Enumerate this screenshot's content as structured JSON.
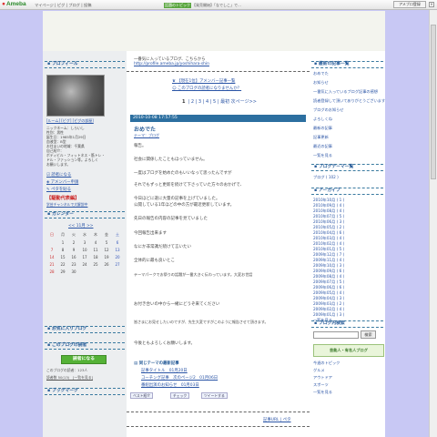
{
  "topbar": {
    "logo": "Ameba",
    "nav": "マイページ | ピグ | ブログ | 投稿",
    "badge": "話題のトピック",
    "mid": "【発売開始】「なでしこ」で…",
    "login_button": "アメブロ登録",
    "close_label": "×"
  },
  "left": {
    "profile_heading": "プロフィール",
    "profile_links": "[ルーム] [ピグ] [ピグの部屋]",
    "profile_lines": [
      "ニックネーム：しらいし",
      "性別：男性",
      "誕生日：1985年1月29日",
      "血液型：B型",
      "お住まいの地域：千葉県",
      "自己紹介：",
      "ボディビル・フィットネス・筋トレ・",
      "ドル・ファッション等。よろしく",
      "お願いします。"
    ],
    "action_links": [
      "読者になる",
      "アメンバー申請",
      "ペタを貼る"
    ],
    "red_title": "【駆動代表編】",
    "red_sub": "学芸チャンネルで大解説中",
    "calendar_heading": "カレンダー",
    "calendar_month": "<< 11月 >>",
    "weekdays": [
      "日",
      "月",
      "火",
      "水",
      "木",
      "金",
      "土"
    ],
    "weeks": [
      [
        "",
        "1",
        "2",
        "3",
        "4",
        "5",
        "6"
      ],
      [
        "7",
        "8",
        "9",
        "10",
        "11",
        "12",
        "13"
      ],
      [
        "14",
        "15",
        "16",
        "17",
        "18",
        "19",
        "20"
      ],
      [
        "21",
        "22",
        "23",
        "24",
        "25",
        "26",
        "27"
      ],
      [
        "28",
        "29",
        "30",
        "",
        "",
        "",
        ""
      ]
    ],
    "links_heading": "お気に入りブログ",
    "reader_heading": "このブログの読者",
    "reader_button": "読者になる",
    "reader_text": "このブログの読者：123人",
    "reader_link": "読者数 50(13)　[一覧を見る]",
    "blog_heading": "ブックマーク"
  },
  "main": {
    "intro_1": "一番気に入っているブログ、こちらから",
    "intro_2": "http://profile.ameba.jp/yoshihara-shin",
    "ranking_link": "【現在1位】アメンバー記事一覧",
    "ranking_link_2": "このブログの読者になりませんか？",
    "pager_pages": [
      "1",
      "2",
      "3",
      "4",
      "5"
    ],
    "pager_prev": "最初",
    "pager_next": "次ページ>>",
    "post_date": "2010-10-08 17:57:55",
    "post_title": "おめでた",
    "post_meta": "テーマ：ブログ",
    "paragraphs": [
      "報告。",
      "社会に関係したこともほっていません。",
      "一度はブログを始めたのもいいなって思ったんですが",
      "それでもずっと更新を続けて下さっていた方々のおかげで、",
      "今日ほどに遂に大量の記事を上げていました。",
      "公開している1年ほどの中の方が最近更新しています。",
      "先日の報告の内容の記事を見ていました",
      "今回報告出来ます",
      "なにか非常識だ続けて言いたい",
      "全体的に最も良いとこ",
      "テーマパークでお祭りの話題が一番大きく伝わっています。大変お世話",
      "お付き合いの中から一緒にどうぞ来てください",
      "皆さまにお見せしたいのですが、先生大変ですがこのように報告させて頂きます。",
      "今後ともよろしくお願いします。"
    ],
    "related_heading": "同じテーマの最新記事",
    "related_items": [
      "記事タイトル　01月20日",
      "コーチング記事　次のページ2　01月06日",
      "番組出演のお知らせ　01月03日"
    ],
    "share_labels": [
      "ベスト紹介",
      "チェック",
      "ツイートする"
    ],
    "footer_link": "記事URL | ペタ"
  },
  "right": {
    "latest_heading": "最新の記事一覧",
    "latest_items": [
      "おめでた",
      "お知らせ",
      "一番気に入っているブログ記事の感想",
      "読者登録して頂いてありがとうございます",
      "ブログのお知らせ",
      "よろしくね",
      "最新の記事",
      "記事更新",
      "最近の記事",
      "一覧を見る"
    ],
    "theme_heading": "ブログテーマ一覧",
    "theme_items": [
      "ブログ ( 102 )"
    ],
    "archive_heading": "アーカイブ",
    "archive_items": [
      "2010年10月 ( 1 )",
      "2010年09月 ( 4 )",
      "2010年08月 ( 4 )",
      "2010年07月 ( 5 )",
      "2010年06月 ( 3 )",
      "2010年05月 ( 2 )",
      "2010年04月 ( 6 )",
      "2010年03月 ( 4 )",
      "2010年02月 ( 4 )",
      "2010年01月 ( 5 )",
      "2009年12月 ( 7 )",
      "2009年11月 ( 4 )",
      "2009年10月 ( 3 )",
      "2009年09月 ( 6 )",
      "2009年08月 ( 4 )",
      "2009年07月 ( 5 )",
      "2009年06月 ( 6 )",
      "2009年05月 ( 4 )",
      "2009年04月 ( 3 )",
      "2009年03月 ( 2 )",
      "2009年02月 ( 4 )",
      "2009年01月 ( 3 )",
      "一覧を見る"
    ],
    "search_heading": "ブログ内検索",
    "search_button": "検索",
    "banner": "芸能人・有名人ブログ",
    "bottom_items": [
      "今週のトピック",
      "グルメ",
      "アウトドア",
      "スポーツ",
      "一覧を見る"
    ]
  },
  "colors": {
    "accent": "#2b5f9a",
    "post_bar": "#2c6fa0",
    "green": "#55b237",
    "background": "#c8c8f4"
  }
}
